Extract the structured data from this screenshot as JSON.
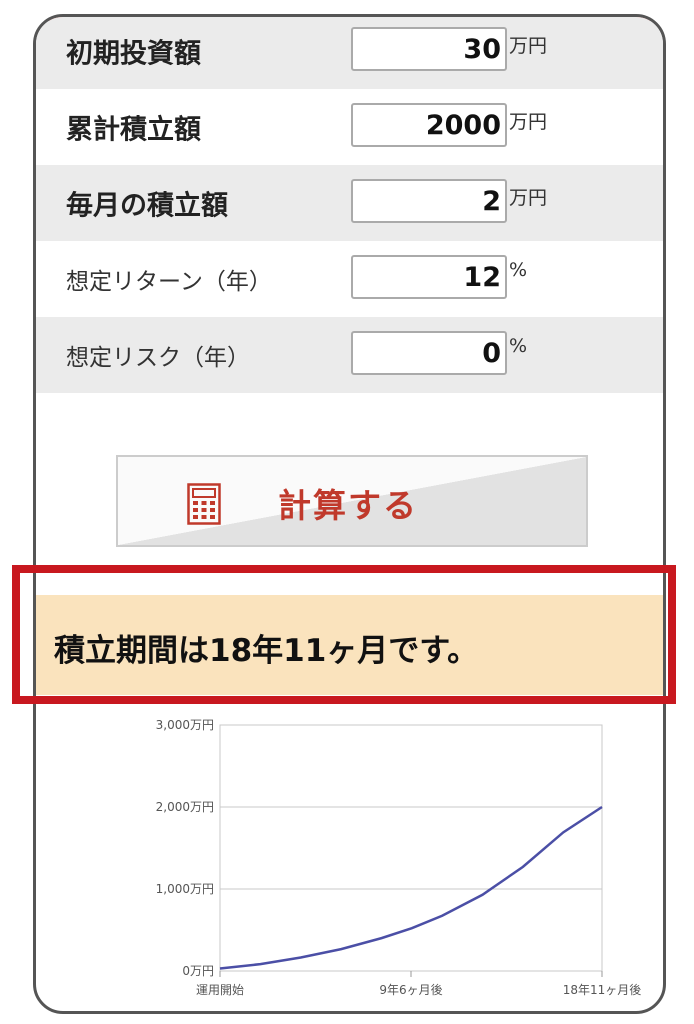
{
  "form": {
    "rows": [
      {
        "label": "初期投資額",
        "value": "30",
        "unit": "万円"
      },
      {
        "label": "累計積立額",
        "value": "2000",
        "unit": "万円"
      },
      {
        "label": "毎月の積立額",
        "value": "2",
        "unit": "万円"
      },
      {
        "label": "想定リターン（年）",
        "value": "12",
        "unit": "%"
      },
      {
        "label": "想定リスク（年）",
        "value": "0",
        "unit": "%"
      }
    ]
  },
  "calculate_button": {
    "label": "計算する",
    "icon": "calculator-icon"
  },
  "result": {
    "text": "積立期間は18年11ヶ月です。"
  },
  "colors": {
    "accent": "#c0392b",
    "highlight_border": "#c8181f",
    "result_bg": "#fae3bd",
    "line": "#4b4fa6"
  },
  "chart_data": {
    "type": "line",
    "x_tick_labels": [
      "運用開始",
      "9年6ヶ月後",
      "18年11ヶ月後"
    ],
    "y_tick_labels": [
      "0万円",
      "1,000万円",
      "2,000万円",
      "3,000万円"
    ],
    "ylim": [
      0,
      3000
    ],
    "xlim": [
      0,
      227
    ],
    "grid": true,
    "series": [
      {
        "x": [
          0,
          24,
          48,
          72,
          96,
          114,
          132,
          156,
          180,
          204,
          227
        ],
        "values": [
          30,
          84,
          165,
          267,
          401,
          522,
          674,
          930,
          1270,
          1691,
          2000
        ]
      }
    ]
  }
}
